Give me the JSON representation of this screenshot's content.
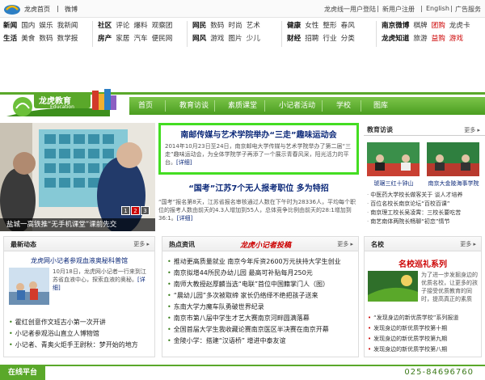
{
  "topbar": {
    "home": "龙虎首页",
    "weibo": "微博",
    "login": "龙虎线一用户登陆",
    "register": "新用户注册",
    "english": "English",
    "ad": "广告服务"
  },
  "channels": {
    "col1": [
      [
        "新闻",
        "国内",
        "娱乐",
        "我新闻"
      ],
      [
        "生活",
        "美食",
        "数码",
        "数学报"
      ]
    ],
    "col2": [
      [
        "社区",
        "评论",
        "爆料",
        "观察团"
      ],
      [
        "房产",
        "家居",
        "汽车",
        "便民网"
      ]
    ],
    "col3": [
      [
        "网民",
        "数码",
        "时尚",
        "艺术"
      ],
      [
        "网风",
        "游戏",
        "图片",
        "少儿"
      ]
    ],
    "col4": [
      [
        "健康",
        "女性",
        "整形",
        "春风"
      ],
      [
        "财经",
        "招聘",
        "行业",
        "分类"
      ]
    ],
    "col5": [
      [
        "南京微博",
        "棋牌",
        "团购",
        "龙虎卡"
      ],
      [
        "龙虎知道",
        "旅游",
        "益购",
        "游戏"
      ]
    ]
  },
  "brand": {
    "logo_text": "龙虎教育",
    "logo_sub": "Education"
  },
  "nav": [
    "首页",
    "教育访谈",
    "素质课堂",
    "小记者活动",
    "学校",
    "图库"
  ],
  "hero": {
    "caption": "盐城一高铁推“无手机课堂”课前先交",
    "pages": [
      "1",
      "2",
      "3"
    ]
  },
  "headline": {
    "title": "南邮传媒与艺术学院举办“三走”趣味运动会",
    "desc": "2014年10月23日至24日，南京邮电大学传媒与艺术学院举办了第二届“三走”趣味运动会，为全体学院学子再添了一个展示青春风采，阳光活力的平台。",
    "detail": "[详细]"
  },
  "sub": {
    "title": "“国考”江苏7个无人报考职位  多为特招",
    "desc": "“国考”报名第8天，江苏省报名审核通过人数在下午时为28336人，平均每个职位的报考人数由前天的4.3人增加到55人，总体竞争比例由前天的28:1增加到36:1。",
    "detail": "[详细]"
  },
  "visit": {
    "title": "教育访谈",
    "more": "更多",
    "captions": [
      "琥琚三红十钟山",
      "南京大金陵海事学院"
    ],
    "list": [
      "中医药大学校长做客关于 谈人才培养",
      "百位名校长南京论坛“百校百课”",
      "南京理工校长吴凌霄：三校长要吃苦",
      "南艺南体两院长畅聊“初恋”情节"
    ]
  },
  "dynamic": {
    "title": "最新动态",
    "more": "更多",
    "headline": "龙虎网小记者参观血液奥秘科普馆",
    "desc": "10月18日，龙虎网小记者一行来到江苏省血液中心，探索血液的奥秘。",
    "detail": "[详细]",
    "items": [
      "霍红创意作文班古小第一次开讲",
      "小记者参观浴山直立人博物馆",
      "小记者、青奥火炬手王尉秋：梦开始的地方"
    ]
  },
  "hot": {
    "title": "热点资讯",
    "badge": "龙虎小记者投稿",
    "more": "更多",
    "items": [
      "推动更高质量就业 南京今年斥资2600万元扶持大学生创业",
      "南京拟增44所民办幼儿园 最高可补贴每月250元",
      "南师大教授赵厚麟当选“电联”首位中国籍掌门人（图）",
      "“晨幼儿园”多次被取缔 家长仍络绎不绝把孩子送来",
      "东南大学力魔车队勇破世界纪录",
      "南京市第八届中学生才艺大赛南京河畔圆满落幕",
      "全国首届大学生我收藏论赛南京医区半决赛在南京开幕",
      "金陵小学：搭建“汉语桥” 增进中泰友谊"
    ]
  },
  "school": {
    "title": "名校",
    "more": "更多",
    "red_title": "名校巡礼系列",
    "desc": "为了进一步发掘身边的优质名校，让更多的孩子接受优质教育的同时，提高真正的素质",
    "items": [
      "“发现身边的新优质学校”系列报道",
      "发现身边的新优质学校第十期",
      "发现身边的新优质学校第九期",
      "发现身边的新优质学校第八期"
    ]
  },
  "footer": {
    "title": "在线平台",
    "phone": "025-84696760"
  },
  "colors": {
    "green": "#5aa82a",
    "headline_blue": "#0d2a7a",
    "red": "#cc0000"
  }
}
